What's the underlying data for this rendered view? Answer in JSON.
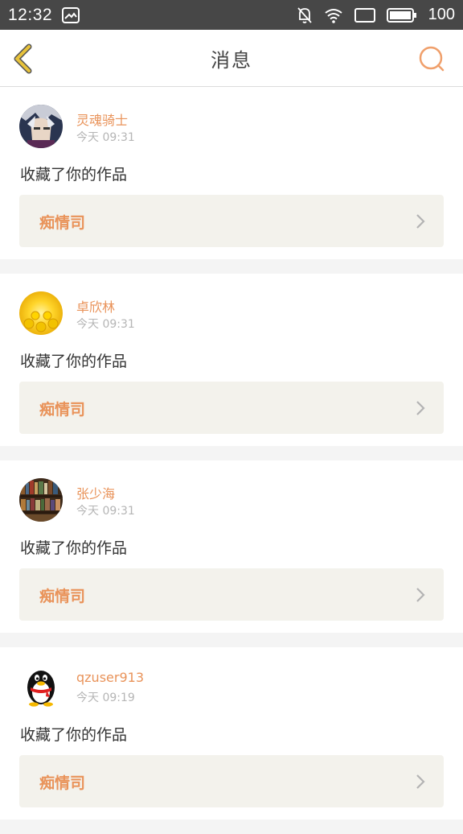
{
  "status_bar": {
    "time": "12:32",
    "battery": "100",
    "icons": [
      "image-icon",
      "bell-off-icon",
      "wifi-icon",
      "screen-icon",
      "battery-icon"
    ]
  },
  "navbar": {
    "title": "消息",
    "back_icon": "back-chevron-icon",
    "search_icon": "search-icon"
  },
  "colors": {
    "accent": "#e9935a",
    "back_icon": "#e7c23b",
    "status_bar_bg": "#474747",
    "work_box_bg": "#f3f2ec"
  },
  "messages": [
    {
      "user": "灵魂骑士",
      "time": "今天 09:31",
      "action": "收藏了你的作品",
      "work": "痴情司",
      "avatar": "anime-avatar"
    },
    {
      "user": "卓欣林",
      "time": "今天 09:31",
      "action": "收藏了你的作品",
      "work": "痴情司",
      "avatar": "sunflower-avatar"
    },
    {
      "user": "张少海",
      "time": "今天 09:31",
      "action": "收藏了你的作品",
      "work": "痴情司",
      "avatar": "bookshelf-avatar"
    },
    {
      "user": "qzuser913",
      "time": "今天 09:19",
      "action": "收藏了你的作品",
      "work": "痴情司",
      "avatar": "penguin-avatar"
    }
  ]
}
